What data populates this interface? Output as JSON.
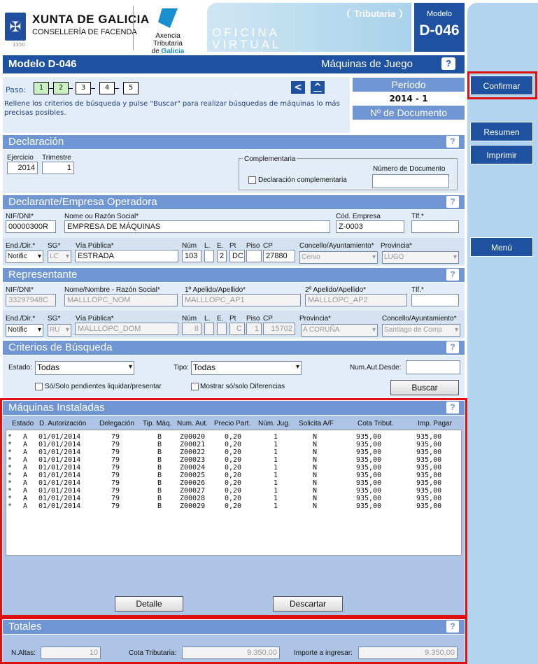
{
  "header": {
    "logo_title": "XUNTA DE GALICIA",
    "logo_subtitle": "CONSELLERÍA DE FACENDA",
    "logo_year": "1350",
    "atg_line1": "Axencia Tributaria",
    "atg_line2_prefix": "de",
    "atg_line2_brand": "Galicia",
    "banner_l1": "OFICINA",
    "banner_l2": "VIRTUAL",
    "tributaria": "Tributaria",
    "model_small": "Modelo",
    "model_big": "D-046"
  },
  "titlebar": {
    "title": "Modelo D-046",
    "right": "Máquinas de Juego",
    "help": "?"
  },
  "paso": {
    "label": "Paso:",
    "steps": [
      "1",
      "2",
      "3",
      "4",
      "5"
    ],
    "hint": "Rellene los criterios de búsqueda y pulse \"Buscar\" para realizar búsquedas de máquinas lo más precisas posibles.",
    "prev": "<",
    "up": "^"
  },
  "periodo": {
    "label": "Período",
    "value": "2014 - 1",
    "doc_label": "Nº de Documento"
  },
  "side": {
    "confirmar": "Confirmar",
    "resumen": "Resumen",
    "imprimir": "Imprimir",
    "menu": "Menú"
  },
  "declaracion": {
    "title": "Declaración",
    "ejercicio_label": "Ejercicio",
    "ejercicio": "2014",
    "trimestre_label": "Trimestre",
    "trimestre": "1",
    "complementaria_legend": "Complementaria",
    "complementaria_check": "Declaración complementaria",
    "numdoc_label": "Número de Documento"
  },
  "declarante": {
    "title": "Declarante/Empresa Operadora",
    "nif_label": "NIF/DNI*",
    "nif": "00000300R",
    "nombre_label": "Nome ou Razón Social*",
    "nombre": "EMPRESA DE MÁQUINAS",
    "cod_label": "Cód. Empresa",
    "cod": "Z-0003",
    "tlf_label": "Tlf.*",
    "enddir_label": "End./Dir.*",
    "enddir": "Notific",
    "sg_label": "SG*",
    "sg": "LC",
    "via_label": "Vía Pública*",
    "via": "ESTRADA",
    "num_label": "Núm",
    "num": "103",
    "l_label": "L.",
    "e_label": "E.",
    "e": "2",
    "pt_label": "Pt",
    "pt": "DC",
    "piso_label": "Piso",
    "cp_label": "CP",
    "cp": "27880",
    "concello_label": "Concello/Ayuntamiento*",
    "concello": "Cervo",
    "provincia_label": "Provincia*",
    "provincia": "LUGO"
  },
  "representante": {
    "title": "Representante",
    "nif_label": "NIF/DNI*",
    "nif": "33297948C",
    "nombre_label": "Nome/Nombre - Razón Social*",
    "nombre": "MALLLOPC_NOM",
    "ap1_label": "1º Apelido/Apellido*",
    "ap1": "MALLLOPC_AP1",
    "ap2_label": "2º Apelido/Apellido*",
    "ap2": "MALLLOPC_AP2",
    "tlf_label": "Tlf.*",
    "enddir_label": "End./Dir.*",
    "enddir": "Notific",
    "sg_label": "SG*",
    "sg": "RU",
    "via_label": "Vía Pública*",
    "via": "MALLLOPC_DOM",
    "num_label": "Núm",
    "num": "8",
    "l_label": "L.",
    "e_label": "E.",
    "pt_label": "Pt",
    "pt": "C",
    "piso_label": "Piso",
    "piso": "1",
    "cp_label": "CP",
    "cp": "15702",
    "provincia_label": "Provincia*",
    "provincia": "A CORUÑA",
    "concello_label": "Concello/Ayuntamiento*",
    "concello": "Santiago de Comp"
  },
  "criterios": {
    "title": "Criterios de Búsqueda",
    "estado_label": "Estado:",
    "estado": "Todas",
    "tipo_label": "Tipo:",
    "tipo": "Todas",
    "numaut_label": "Num.Aut.Desde:",
    "pend_label": "Só/Solo pendientes liquidar/presentar",
    "dif_label": "Mostrar só/solo Diferencias",
    "buscar": "Buscar"
  },
  "maquinas": {
    "title": "Máquinas Instaladas",
    "headers": [
      "Estado",
      "D. Autorización",
      "Delegación",
      "Tip. Máq.",
      "Num. Aut.",
      "Precio Part.",
      "Núm. Jug.",
      "Solicita A/F",
      "Cota Tribut.",
      "Imp. Pagar"
    ],
    "rows": [
      [
        "*",
        "A",
        "01/01/2014",
        "79",
        "B",
        "Z00020",
        "0,20",
        "1",
        "N",
        "935,00",
        "935,00"
      ],
      [
        "*",
        "A",
        "01/01/2014",
        "79",
        "B",
        "Z00021",
        "0,20",
        "1",
        "N",
        "935,00",
        "935,00"
      ],
      [
        "*",
        "A",
        "01/01/2014",
        "79",
        "B",
        "Z00022",
        "0,20",
        "1",
        "N",
        "935,00",
        "935,00"
      ],
      [
        "*",
        "A",
        "01/01/2014",
        "79",
        "B",
        "Z00023",
        "0,20",
        "1",
        "N",
        "935,00",
        "935,00"
      ],
      [
        "*",
        "A",
        "01/01/2014",
        "79",
        "B",
        "Z00024",
        "0,20",
        "1",
        "N",
        "935,00",
        "935,00"
      ],
      [
        "*",
        "A",
        "01/01/2014",
        "79",
        "B",
        "Z00025",
        "0,20",
        "1",
        "N",
        "935,00",
        "935,00"
      ],
      [
        "*",
        "A",
        "01/01/2014",
        "79",
        "B",
        "Z00026",
        "0,20",
        "1",
        "N",
        "935,00",
        "935,00"
      ],
      [
        "*",
        "A",
        "01/01/2014",
        "79",
        "B",
        "Z00027",
        "0,20",
        "1",
        "N",
        "935,00",
        "935,00"
      ],
      [
        "*",
        "A",
        "01/01/2014",
        "79",
        "B",
        "Z00028",
        "0,20",
        "1",
        "N",
        "935,00",
        "935,00"
      ],
      [
        "*",
        "A",
        "01/01/2014",
        "79",
        "B",
        "Z00029",
        "0,20",
        "1",
        "N",
        "935,00",
        "935,00"
      ]
    ],
    "detalle": "Detalle",
    "descartar": "Descartar"
  },
  "totales": {
    "title": "Totales",
    "altas_label": "N.Altas:",
    "altas": "10",
    "cota_label": "Cota Tributaria:",
    "cota": "9.350,00",
    "importe_label": "Importe a ingresar:",
    "importe": "9.350,00"
  },
  "colors": {
    "primary": "#1e52a0",
    "section": "#6f95d2",
    "panel": "#e3edf7",
    "highlight": "#d11"
  }
}
